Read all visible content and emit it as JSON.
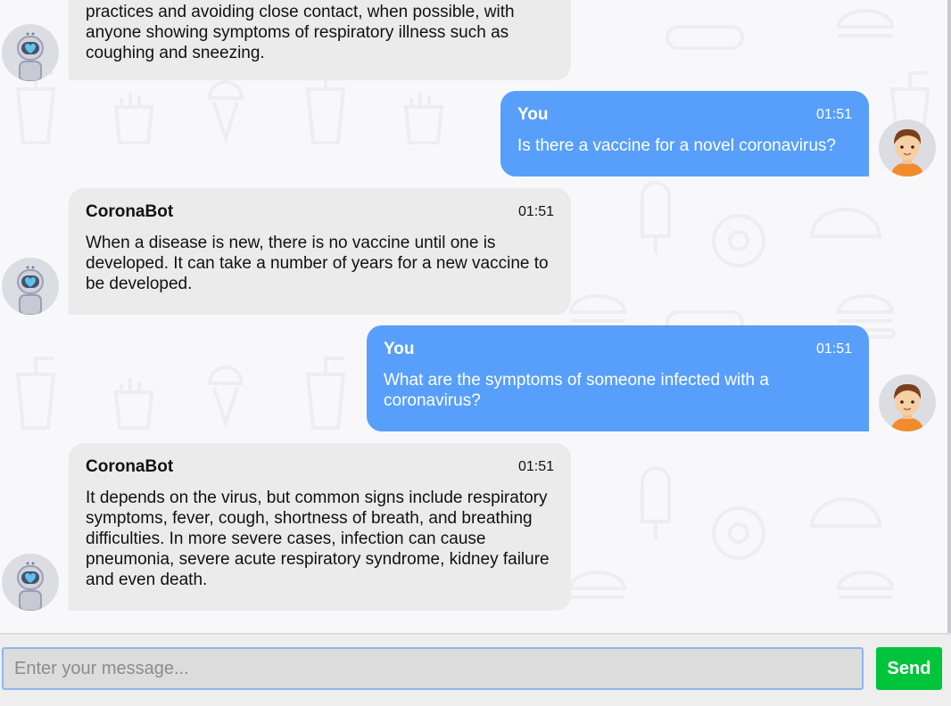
{
  "messages": [
    {
      "sender": "bot",
      "name": "",
      "time": "",
      "text": "practices and avoiding close contact, when possible, with anyone showing symptoms of respiratory illness such as coughing and sneezing."
    },
    {
      "sender": "user",
      "name": "You",
      "time": "01:51",
      "text": "Is there a vaccine for a novel coronavirus?"
    },
    {
      "sender": "bot",
      "name": "CoronaBot",
      "time": "01:51",
      "text": "When a disease is new, there is no vaccine until one is developed. It can take a number of years for a new vaccine to be developed."
    },
    {
      "sender": "user",
      "name": "You",
      "time": "01:51",
      "text": "What are the symptoms of someone infected with a coronavirus?"
    },
    {
      "sender": "bot",
      "name": "CoronaBot",
      "time": "01:51",
      "text": "It depends on the virus, but common signs include respiratory symptoms, fever, cough, shortness of breath, and breathing difficulties. In more severe cases, infection can cause pneumonia, severe acute respiratory syndrome, kidney failure and even death."
    }
  ],
  "input": {
    "placeholder": "Enter your message...",
    "value": ""
  },
  "send_label": "Send",
  "colors": {
    "user_bubble": "#579ffb",
    "bot_bubble": "#ebebeb",
    "send_button": "#00c53b"
  },
  "icons": {
    "bot_avatar": "robot-icon",
    "user_avatar": "boy-avatar-icon"
  }
}
